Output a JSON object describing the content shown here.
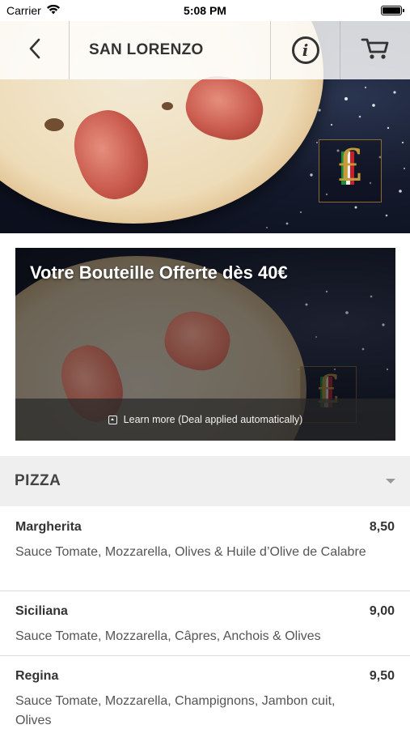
{
  "status_bar": {
    "carrier": "Carrier",
    "time": "5:08 PM",
    "icons": [
      "wifi-icon",
      "battery-icon"
    ]
  },
  "nav": {
    "title": "SAN LORENZO",
    "back_icon": "chevron-left-icon",
    "info_icon": "info-icon",
    "cart_icon": "cart-icon"
  },
  "promo": {
    "title": "Votre Bouteille Offerte dès 40€",
    "footer": "Learn more (Deal applied automatically)"
  },
  "category": {
    "title": "PIZZA",
    "icon": "chevron-down-icon"
  },
  "menu_items": [
    {
      "name": "Margherita",
      "price": "8,50",
      "description": "Sauce Tomate, Mozzarella, Olives & Huile d’Olive de Calabre"
    },
    {
      "name": "Siciliana",
      "price": "9,00",
      "description": "Sauce Tomate, Mozzarella, Câpres, Anchois & Olives"
    },
    {
      "name": "Regina",
      "price": "9,50",
      "description": "Sauce Tomate, Mozzarella, Champignons, Jambon cuit, Olives"
    }
  ],
  "colors": {
    "nav_bg": "#ffffff",
    "text": "#333333",
    "category_bg": "#efefef",
    "promo_footer_bg": "#282828"
  }
}
